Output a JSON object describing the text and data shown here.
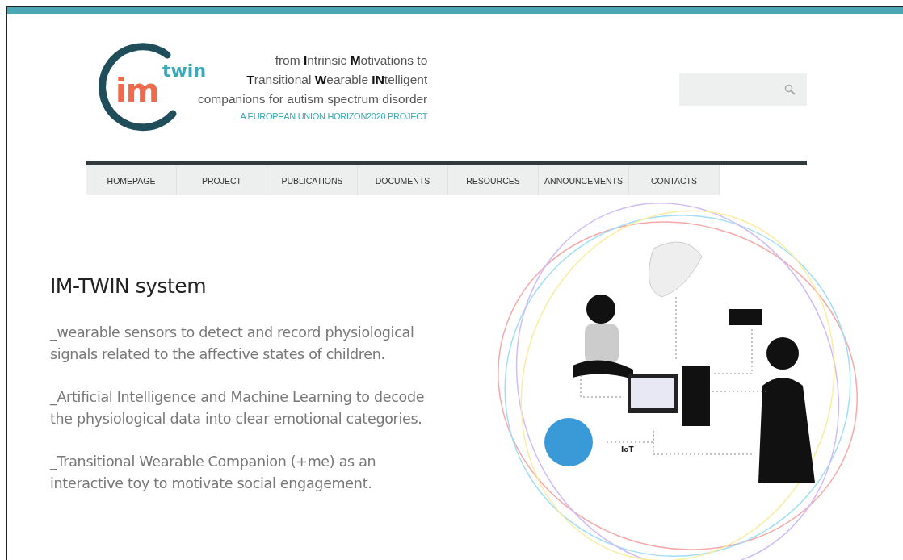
{
  "logo": {
    "mark_im": "im",
    "mark_twin": "twin",
    "tagline": [
      "from **I**ntrinsic **M**otivations to",
      "**T**ransitional **W**earable **IN**telligent",
      "companions for autism spectrum disorder"
    ],
    "subtitle": "A EUROPEAN UNION HORIZON2020 PROJECT"
  },
  "nav": [
    {
      "label": "HOMEPAGE",
      "selected": false
    },
    {
      "label": "PROJECT",
      "selected": false
    },
    {
      "label": "PUBLICATIONS",
      "selected": false
    },
    {
      "label": "DOCUMENTS",
      "selected": false
    },
    {
      "label": "RESOURCES",
      "selected": false
    },
    {
      "label": "ANNOUNCEMENTS",
      "selected": false
    },
    {
      "label": "CONTACTS",
      "selected": false
    }
  ],
  "intro": {
    "heading": "IM-TWIN system",
    "paragraphs": [
      "_wearable sensors to detect and record physiological signals related to the affective states of children.",
      "_Artificial Intelligence and Machine Learning to decode the physiological data into clear emotional categories.",
      "_Transitional Wearable Companion (+me) as an interactive toy to motivate social engagement."
    ]
  },
  "diagram": {
    "iot_label": "IoT"
  }
}
